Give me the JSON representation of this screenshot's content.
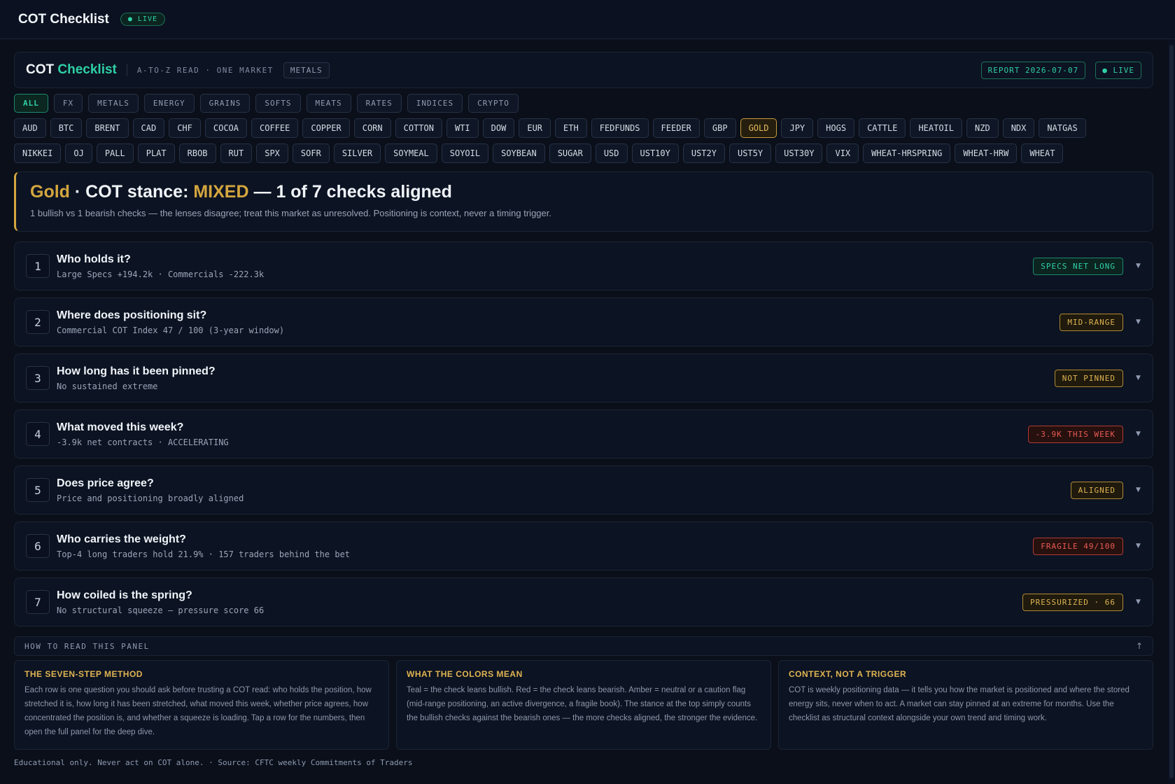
{
  "topbar": {
    "title": "COT Checklist",
    "live": "● LIVE"
  },
  "header": {
    "title_plain": "COT",
    "title_accent": "Checklist",
    "subtitle": "A-TO-Z READ · ONE MARKET",
    "sector_chip": "METALS",
    "report": "REPORT 2026-07-07",
    "live": "● LIVE"
  },
  "categories": [
    "ALL",
    "FX",
    "METALS",
    "ENERGY",
    "GRAINS",
    "SOFTS",
    "MEATS",
    "RATES",
    "INDICES",
    "CRYPTO"
  ],
  "tickers_row1": [
    "AUD",
    "BTC",
    "BRENT",
    "CAD",
    "CHF",
    "COCOA",
    "COFFEE",
    "COPPER",
    "CORN",
    "COTTON",
    "WTI",
    "DOW",
    "EUR",
    "ETH",
    "FEDFUNDS",
    "FEEDER",
    "GBP",
    "GOLD",
    "JPY",
    "HOGS",
    "CATTLE",
    "HEATOIL",
    "NZD",
    "NDX",
    "NATGAS"
  ],
  "tickers_row2": [
    "NIKKEI",
    "OJ",
    "PALL",
    "PLAT",
    "RBOB",
    "RUT",
    "SPX",
    "SOFR",
    "SILVER",
    "SOYMEAL",
    "SOYOIL",
    "SOYBEAN",
    "SUGAR",
    "USD",
    "UST10Y",
    "UST2Y",
    "UST5Y",
    "UST30Y",
    "VIX",
    "WHEAT-HRSPRING",
    "WHEAT-HRW",
    "WHEAT"
  ],
  "selected_ticker": "GOLD",
  "stance": {
    "market": "Gold",
    "mid": " · COT stance: ",
    "verdict": "MIXED",
    "tail": " — 1 of 7 checks aligned",
    "description": "1 bullish vs 1 bearish checks — the lenses disagree; treat this market as unresolved. Positioning is context, never a timing trigger."
  },
  "checks": [
    {
      "num": "1",
      "question": "Who holds it?",
      "detail": "Large Specs +194.2k · Commercials -222.3k",
      "badge": "SPECS NET LONG",
      "tone": "teal"
    },
    {
      "num": "2",
      "question": "Where does positioning sit?",
      "detail": "Commercial COT Index 47 / 100 (3-year window)",
      "badge": "MID-RANGE",
      "tone": "amber"
    },
    {
      "num": "3",
      "question": "How long has it been pinned?",
      "detail": "No sustained extreme",
      "badge": "NOT PINNED",
      "tone": "amber"
    },
    {
      "num": "4",
      "question": "What moved this week?",
      "detail": "-3.9k net contracts · ACCELERATING",
      "badge": "-3.9K THIS WEEK",
      "tone": "red"
    },
    {
      "num": "5",
      "question": "Does price agree?",
      "detail": "Price and positioning broadly aligned",
      "badge": "ALIGNED",
      "tone": "amber"
    },
    {
      "num": "6",
      "question": "Who carries the weight?",
      "detail": "Top-4 long traders hold 21.9% · 157 traders behind the bet",
      "badge": "FRAGILE 49/100",
      "tone": "red"
    },
    {
      "num": "7",
      "question": "How coiled is the spring?",
      "detail": "No structural squeeze — pressure score 66",
      "badge": "PRESSURIZED · 66",
      "tone": "amber"
    }
  ],
  "howto": {
    "label": "HOW TO READ THIS PANEL",
    "arrow": "↑"
  },
  "explain": [
    {
      "title": "THE SEVEN-STEP METHOD",
      "text": "Each row is one question you should ask before trusting a COT read: who holds the position, how stretched it is, how long it has been stretched, what moved this week, whether price agrees, how concentrated the position is, and whether a squeeze is loading. Tap a row for the numbers, then open the full panel for the deep dive."
    },
    {
      "title": "WHAT THE COLORS MEAN",
      "text": "Teal = the check leans bullish. Red = the check leans bearish. Amber = neutral or a caution flag (mid-range positioning, an active divergence, a fragile book). The stance at the top simply counts the bullish checks against the bearish ones — the more checks aligned, the stronger the evidence."
    },
    {
      "title": "CONTEXT, NOT A TRIGGER",
      "text": "COT is weekly positioning data — it tells you how the market is positioned and where the stored energy sits, never when to act. A market can stay pinned at an extreme for months. Use the checklist as structural context alongside your own trend and timing work."
    }
  ],
  "footer": "Educational only. Never act on COT alone. · Source: CFTC weekly Commitments of Traders",
  "colors": {
    "teal": "#2fd0a6",
    "amber": "#e0b452",
    "red": "#ec5a52",
    "gold": "#d4a63f",
    "background": "#0a0f1a"
  }
}
